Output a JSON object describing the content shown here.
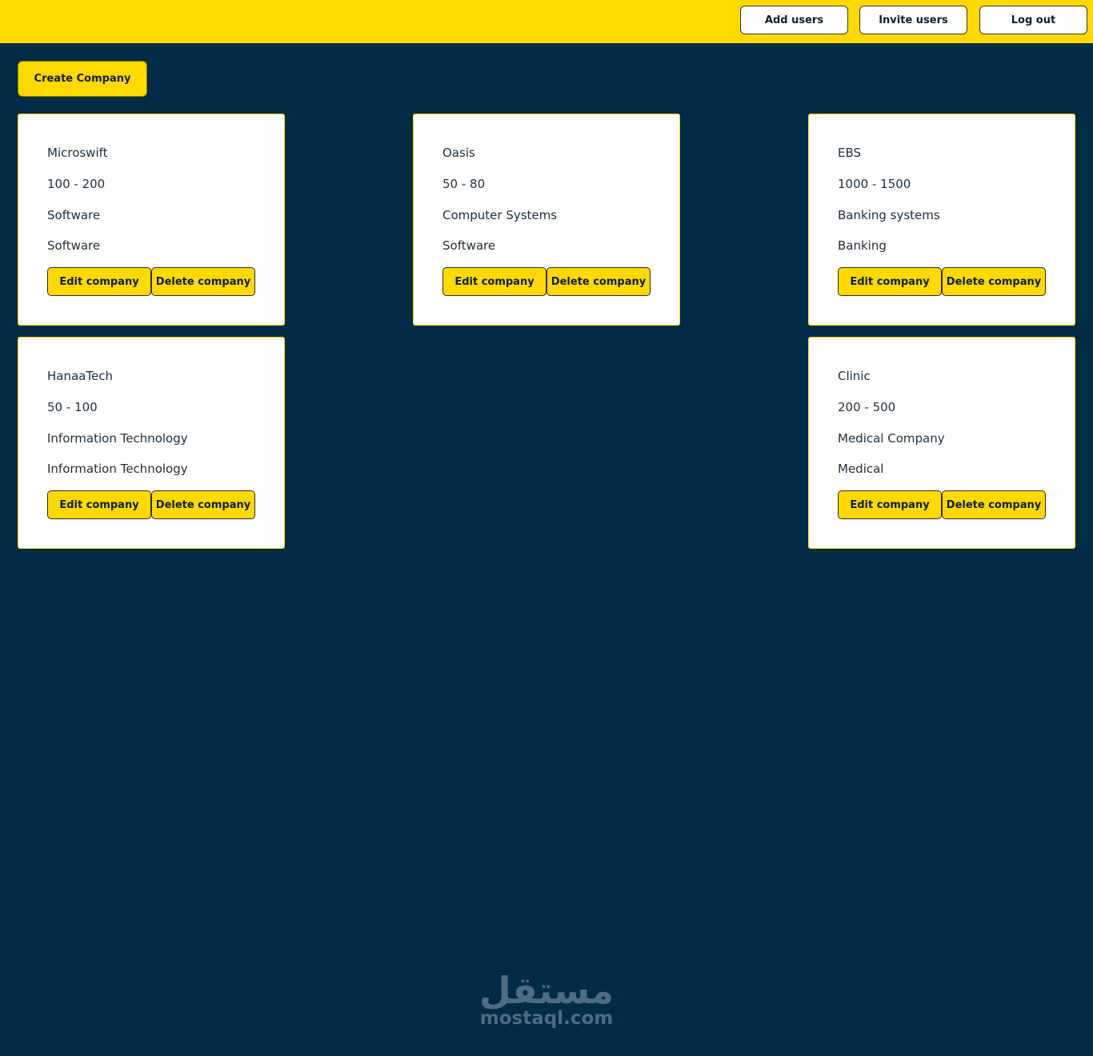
{
  "header": {
    "add_users_label": "Add users",
    "invite_users_label": "Invite users",
    "logout_label": "Log out"
  },
  "toolbar": {
    "create_company_label": "Create Company"
  },
  "companies": [
    {
      "name": "Microswift",
      "size": "100 - 200",
      "description": "Software",
      "industry": "Software",
      "edit_label": "Edit company",
      "delete_label": "Delete company"
    },
    {
      "name": "Oasis",
      "size": "50 - 80",
      "description": "Computer Systems",
      "industry": "Software",
      "edit_label": "Edit company",
      "delete_label": "Delete company"
    },
    {
      "name": "EBS",
      "size": "1000 - 1500",
      "description": "Banking systems",
      "industry": "Banking",
      "edit_label": "Edit company",
      "delete_label": "Delete company"
    },
    {
      "name": "HanaaTech",
      "size": "50 - 100",
      "description": "Information Technology",
      "industry": "Information Technology",
      "edit_label": "Edit company",
      "delete_label": "Delete company"
    },
    {
      "name": "Clinic",
      "size": "200 - 500",
      "description": "Medical Company",
      "industry": "Medical",
      "edit_label": "Edit company",
      "delete_label": "Delete company"
    }
  ],
  "watermark": {
    "arabic": "مستقل",
    "latin": "mostaql.com"
  },
  "colors": {
    "accent": "#ffd900",
    "background": "#022b45",
    "card": "#ffffff"
  }
}
